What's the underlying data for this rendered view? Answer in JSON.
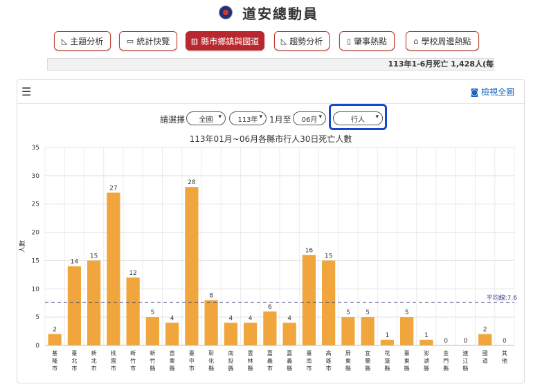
{
  "header": {
    "title": "道安總動員"
  },
  "nav": [
    {
      "label": "主題分析",
      "icon": "area-chart-icon",
      "active": false
    },
    {
      "label": "統計快覽",
      "icon": "card-icon",
      "active": false
    },
    {
      "label": "縣市鄉鎮與國道",
      "icon": "bar-chart-icon",
      "active": true
    },
    {
      "label": "趨勢分析",
      "icon": "area-chart-icon",
      "active": false
    },
    {
      "label": "肇事熱點",
      "icon": "map-icon",
      "active": false
    },
    {
      "label": "學校周邊熱點",
      "icon": "school-icon",
      "active": false
    }
  ],
  "ticker": "113年1-6月死亡 1,428人(每",
  "card": {
    "fullview_label": "檢視全圖"
  },
  "filters": {
    "prompt": "請選擇",
    "region": "全國",
    "year": "113年",
    "month_from_text": "1月至",
    "month_to": "06月",
    "category": "行人"
  },
  "chart_data": {
    "type": "bar",
    "title": "113年01月~06月各縣市行人30日死亡人數",
    "ylabel": "人數",
    "xlabel": "",
    "ylim": [
      0,
      35
    ],
    "yticks": [
      0,
      5,
      10,
      15,
      20,
      25,
      30,
      35
    ],
    "grid": true,
    "bar_color": "#f0a63c",
    "categories": [
      "基隆市",
      "臺北市",
      "新北市",
      "桃園市",
      "新竹市",
      "新竹縣",
      "苗栗縣",
      "臺中市",
      "彰化縣",
      "南投縣",
      "雲林縣",
      "嘉義市",
      "嘉義縣",
      "臺南市",
      "高雄市",
      "屏東縣",
      "宜蘭縣",
      "花蓮縣",
      "臺東縣",
      "澎湖縣",
      "金門縣",
      "連江縣",
      "國道",
      "其他"
    ],
    "values": [
      2,
      14,
      15,
      27,
      12,
      5,
      4,
      28,
      8,
      4,
      4,
      6,
      4,
      16,
      15,
      5,
      5,
      1,
      5,
      1,
      0,
      0,
      2,
      0
    ],
    "average": {
      "label": "平均線:7.6",
      "value": 7.6
    }
  }
}
